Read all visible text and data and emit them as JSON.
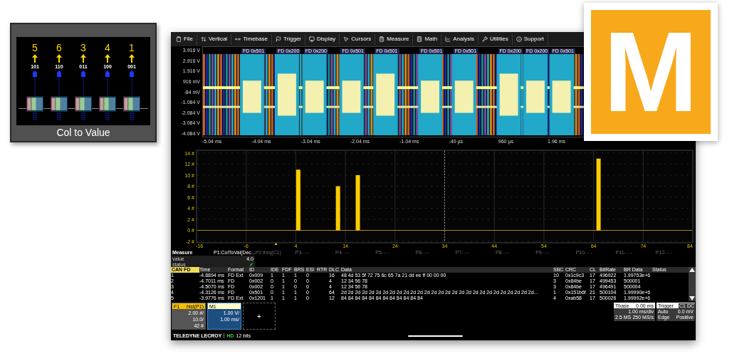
{
  "card": {
    "columns": [
      {
        "value": "5",
        "bits": "101"
      },
      {
        "value": "6",
        "bits": "110"
      },
      {
        "value": "3",
        "bits": "011"
      },
      {
        "value": "4",
        "bits": "100"
      },
      {
        "value": "1",
        "bits": "001"
      }
    ],
    "caption": "Col to Value"
  },
  "logo": {
    "letter": "M"
  },
  "scope": {
    "menu": [
      {
        "label": "File"
      },
      {
        "label": "Vertical"
      },
      {
        "label": "Timebase"
      },
      {
        "label": "Trigger"
      },
      {
        "label": "Display"
      },
      {
        "label": "Cursors"
      },
      {
        "label": "Measure"
      },
      {
        "label": "Math"
      },
      {
        "label": "Analysis"
      },
      {
        "label": "Utilities"
      },
      {
        "label": "Support"
      }
    ],
    "waveform": {
      "y_labels": [
        "3.916 V",
        "2.916 V",
        "1.916 V",
        "916 mV",
        "-84 mV",
        "-1.084 V",
        "-2.084 V",
        "-3.084 V",
        "-4.084 V"
      ],
      "x_labels": [
        "-5.04 ms",
        "-4.04 ms",
        "-3.04 ms",
        "-2.04 ms",
        "-1.04 ms",
        "-40 µs",
        "960 µs",
        "1.96 ms"
      ],
      "frame_labels": [
        "FD 0x501",
        "FD 0x200",
        "FD 0x200",
        "FD 0x501",
        "FD 0x501",
        "FD 0x501",
        "FD 0x501",
        "FD 0x200",
        "FD 0x200",
        "FD 0x501"
      ]
    },
    "histogram": {
      "chart_data": {
        "type": "bar",
        "x": [
          4.5,
          12.5,
          16.5,
          65
        ],
        "values": [
          11,
          8,
          10,
          13
        ],
        "xlim": [
          -16,
          84
        ],
        "ylim": [
          -2,
          14
        ],
        "grid": true,
        "ref_lines": [
          {
            "axis": "x",
            "value": 34
          },
          {
            "axis": "y",
            "value": 0
          }
        ],
        "xticks": [
          -16,
          -6,
          4,
          14,
          24,
          34,
          44,
          54,
          64,
          74,
          84
        ],
        "yticks": [
          {
            "value": -2,
            "label": "-2 #"
          },
          {
            "value": 0,
            "label": "0 #"
          },
          {
            "value": 2,
            "label": "2 #"
          },
          {
            "value": 4,
            "label": "4 #"
          },
          {
            "value": 6,
            "label": "6 #"
          },
          {
            "value": 8,
            "label": "8 #"
          },
          {
            "value": 10,
            "label": "10 #"
          },
          {
            "value": 12,
            "label": "12 #"
          },
          {
            "value": 14,
            "label": "14 #"
          }
        ]
      }
    },
    "measure": {
      "title": "Measure",
      "params": [
        {
          "label": "P1:ColToVal(Dec...",
          "selected": true
        },
        {
          "label": "P2:freq(C1)",
          "selected": false
        },
        {
          "label": "P3- - -",
          "selected": false
        },
        {
          "label": "P4- - -",
          "selected": false
        },
        {
          "label": "P5- - -",
          "selected": false
        },
        {
          "label": "P6- - -",
          "selected": false
        },
        {
          "label": "P7- - -",
          "selected": false
        },
        {
          "label": "P8- - -",
          "selected": false
        },
        {
          "label": "P9- - -",
          "selected": false
        },
        {
          "label": "P10- - -",
          "selected": false
        },
        {
          "label": "P11- - -",
          "selected": false
        },
        {
          "label": "P12- - -",
          "selected": false
        }
      ],
      "rows": [
        {
          "label": "value",
          "kind": "text",
          "value": "4.0"
        },
        {
          "label": "status",
          "kind": "check",
          "value": "✓"
        }
      ]
    },
    "table": {
      "columns": [
        "CAN FD",
        "Time",
        "Format",
        "ID",
        "IDE",
        "FDF",
        "BRS",
        "ESI",
        "RTR",
        "DLC",
        "Data",
        "SBC",
        "CRC",
        "CL",
        "BitRate",
        "BR Data",
        "Status"
      ],
      "rows": [
        [
          "1",
          "-4.8894 ms",
          "FD Ext",
          "0x009",
          "1",
          "1",
          "1",
          "0",
          "",
          "16",
          "48 4d 53 5f 72 75 6c 65 7a 21 dd ee ff 00 00 00",
          "10",
          "0x1c9c3",
          "17",
          "496922",
          "1.99753e+6",
          ""
        ],
        [
          "2",
          "-4.7011 ms",
          "FD",
          "0x002",
          "0",
          "1",
          "0",
          "0",
          "",
          "4",
          "12 34 56 78",
          "3",
          "0x84be",
          "17",
          "499453",
          "500001",
          ""
        ],
        [
          "3",
          "-4.5070 ms",
          "FD",
          "0x002",
          "0",
          "1",
          "0",
          "0",
          "",
          "4",
          "12 34 56 78",
          "3",
          "0x84be",
          "17",
          "496491",
          "500004",
          ""
        ],
        [
          "4",
          "-4.3126 ms",
          "FD",
          "0x501",
          "0",
          "1",
          "1",
          "0",
          "",
          "64",
          "2d 2d 2d 2d 2d 2d 2d 2d 2d 2d 2d 2d 2d 2d 2d 2d 2d 2d 2d 2d 2d 2d 2d 2d 2d 2d 2d 2d...",
          "1",
          "0x151b6f",
          "21",
          "500104",
          "1.99990e+6",
          ""
        ],
        [
          "5",
          "-3.9776 ms",
          "FD Ext",
          "0x1201",
          "1",
          "1",
          "1",
          "0",
          "",
          "12",
          "84 84 84 84 84 84 84 84 84 84 84 84",
          "4",
          "0xab58",
          "17",
          "500026",
          "1.99992e+6",
          ""
        ]
      ]
    },
    "traces": [
      {
        "name": "F1",
        "source": "hist(P1)",
        "color": "#f5c000",
        "selected": false,
        "lines": [
          "2.00 #/",
          "10.0/",
          "42 #"
        ]
      },
      {
        "name": "M1",
        "color": "#ffffc8",
        "selected": true,
        "lines": [
          "1.00 V/",
          "1.00 ms/"
        ]
      }
    ],
    "add_label": "+",
    "timebase": {
      "title": "Tbase",
      "offset": "0.00 ms",
      "rows": [
        [
          "",
          "1.00 ms/div"
        ],
        [
          "2.5 MS",
          "250 MS/s"
        ]
      ]
    },
    "trigger": {
      "title": "Trigger",
      "badge": "C1 DC",
      "rows": [
        [
          "Auto",
          "0.0 mV"
        ],
        [
          "Edge",
          "Positive"
        ]
      ]
    },
    "footer": {
      "brand": "TELEDYNE LECROY",
      "hd": "HD",
      "bits": "12 bits"
    }
  }
}
